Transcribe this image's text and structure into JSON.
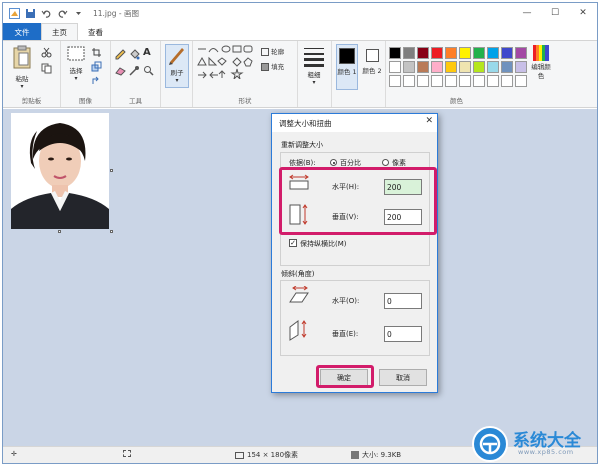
{
  "window": {
    "title": "11.jpg - 画图",
    "minimize": "—",
    "maximize": "☐",
    "close": "✕"
  },
  "tabs": {
    "file": "文件",
    "home": "主页",
    "view": "查看"
  },
  "ribbon": {
    "clipboard": {
      "label": "剪贴板",
      "paste": "粘贴"
    },
    "image": {
      "label": "图像",
      "select": "选择"
    },
    "tools": {
      "label": "工具"
    },
    "brushes": {
      "label": "刷子"
    },
    "shapes": {
      "label": "形状",
      "outline": "轮廓",
      "fill": "填充"
    },
    "size": {
      "label": "粗细"
    },
    "color1": {
      "label": "颜色 1"
    },
    "color2": {
      "label": "颜色 2"
    },
    "colors": {
      "label": "颜色"
    },
    "edit_colors": {
      "label": "编辑颜色"
    },
    "palette": [
      "#000000",
      "#7f7f7f",
      "#880015",
      "#ed1c24",
      "#ff7f27",
      "#fff200",
      "#22b14c",
      "#00a2e8",
      "#3f48cc",
      "#a349a4",
      "#ffffff",
      "#c3c3c3",
      "#b97a57",
      "#ffaec9",
      "#ffc90e",
      "#efe4b0",
      "#b5e61d",
      "#99d9ea",
      "#7092be",
      "#c8bfe7",
      "#ffffff",
      "#ffffff",
      "#ffffff",
      "#ffffff",
      "#ffffff",
      "#ffffff",
      "#ffffff",
      "#ffffff",
      "#ffffff",
      "#ffffff"
    ]
  },
  "dialog": {
    "title": "调整大小和扭曲",
    "resize": {
      "legend": "重新调整大小",
      "by_label": "依据(B):",
      "percent": "百分比",
      "pixels": "像素",
      "horizontal_label": "水平(H):",
      "horizontal_value": "200",
      "vertical_label": "垂直(V):",
      "vertical_value": "200",
      "keep_ratio": "保持纵横比(M)"
    },
    "skew": {
      "legend": "倾斜(角度)",
      "horizontal_label": "水平(O):",
      "horizontal_value": "0",
      "vertical_label": "垂直(E):",
      "vertical_value": "0"
    },
    "ok": "确定",
    "cancel": "取消"
  },
  "status": {
    "dimensions": "154 × 180像素",
    "file_size": "大小: 9.3KB"
  },
  "watermark": {
    "text": "系统大全",
    "url": "www.xp85.com"
  }
}
